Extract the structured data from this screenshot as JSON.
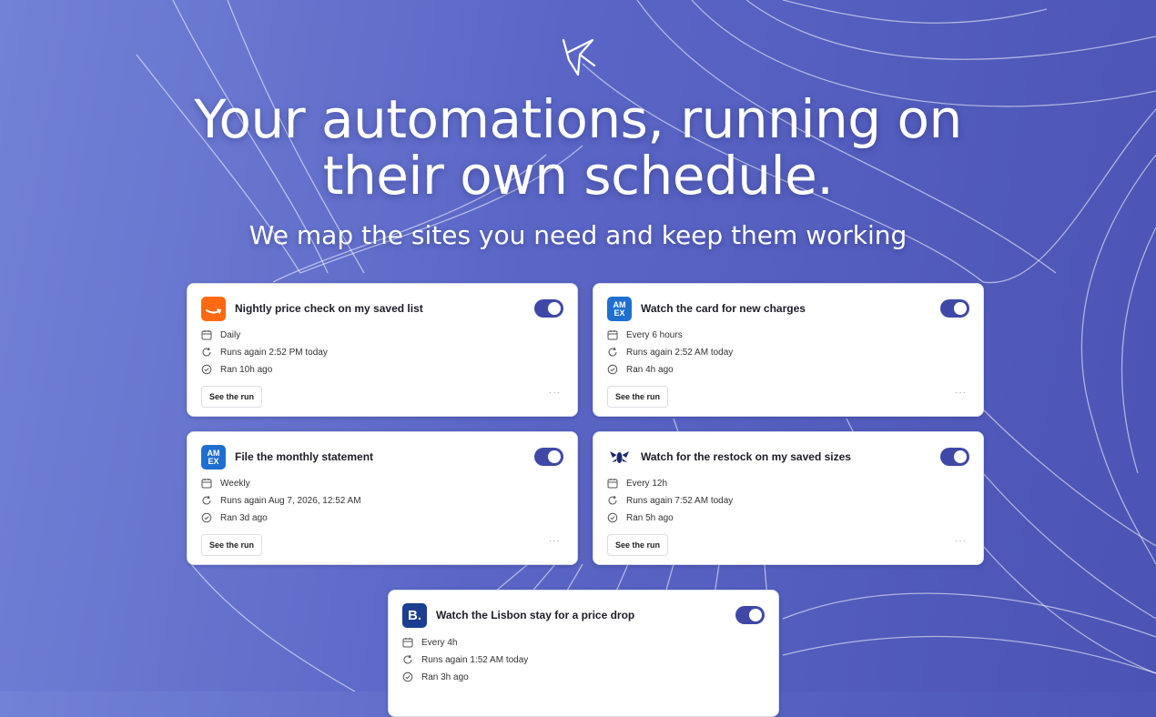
{
  "hero": {
    "headline_line1": "Your automations, running on",
    "headline_line2": "their own schedule.",
    "subheadline": "We map the sites you need and keep them working"
  },
  "cards": [
    {
      "icon": "amazon-icon",
      "title": "Nightly price check on my saved list",
      "schedule": "Daily",
      "next_run": "Runs again 2:52 PM today",
      "last_run": "Ran 10h ago",
      "button": "See the run",
      "more": "···",
      "enabled": true
    },
    {
      "icon": "amex-icon",
      "title": "Watch the card for new charges",
      "schedule": "Every 6 hours",
      "next_run": "Runs again 2:52 AM today",
      "last_run": "Ran 4h ago",
      "button": "See the run",
      "more": "···",
      "enabled": true
    },
    {
      "icon": "amex-icon",
      "title": "File the monthly statement",
      "schedule": "Weekly",
      "next_run": "Runs again Aug 7, 2026, 12:52 AM",
      "last_run": "Ran 3d ago",
      "button": "See the run",
      "more": "···",
      "enabled": true
    },
    {
      "icon": "bee-icon",
      "title": "Watch for the restock on my saved sizes",
      "schedule": "Every 12h",
      "next_run": "Runs again 7:52 AM today",
      "last_run": "Ran 5h ago",
      "button": "See the run",
      "more": "···",
      "enabled": true
    },
    {
      "icon": "booking-icon",
      "title": "Watch the Lisbon stay for a price drop",
      "schedule": "Every 4h",
      "next_run": "Runs again 1:52 AM today",
      "last_run": "Ran 3h ago",
      "enabled": true
    }
  ],
  "brand": {
    "amex_text_1": "AM",
    "amex_text_2": "EX",
    "booking_text": "B."
  },
  "colors": {
    "toggle_on": "#3f48a7",
    "amazon": "#ff6a13",
    "amex": "#1f6fd1",
    "booking": "#1b3e91"
  }
}
